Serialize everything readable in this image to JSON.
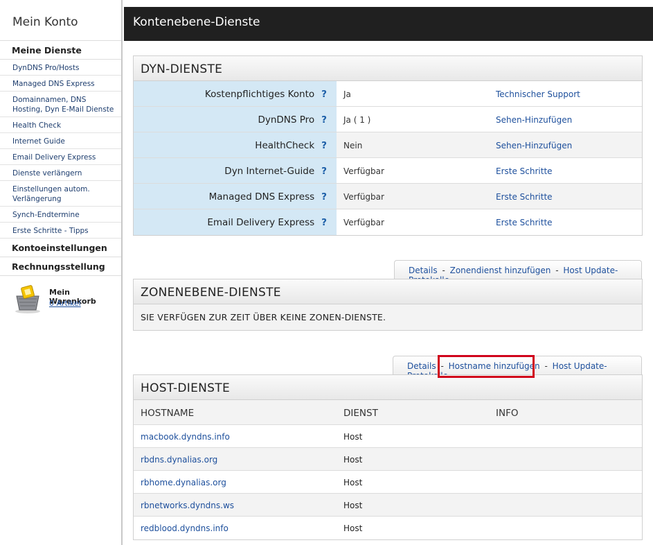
{
  "sidebar": {
    "title": "Mein Konto",
    "section_services": "Meine Dienste",
    "items": [
      "DynDNS Pro/Hosts",
      "Managed DNS Express",
      "Domainnamen, DNS Hosting, Dyn E-Mail Dienste",
      "Health Check",
      "Internet Guide",
      "Email Delivery Express",
      "Dienste verlängern",
      "Einstellungen autom. Verlängerung",
      "Synch-Endtermine",
      "Erste Schritte - Tipps"
    ],
    "section_account": "Kontoeinstellungen",
    "section_billing": "Rechnungsstellung",
    "cart": {
      "title": "Mein Warenkorb",
      "count": "0 Artikel"
    }
  },
  "header": {
    "title": "Kontenebene-Dienste"
  },
  "dyn": {
    "title": "DYN-DIENSTE",
    "help": "?",
    "rows": [
      {
        "label": "Kostenpflichtiges Konto",
        "value": "Ja",
        "link": "Technischer Support"
      },
      {
        "label": "DynDNS Pro",
        "value": "Ja ( 1 )",
        "link": "Sehen-Hinzufügen"
      },
      {
        "label": "HealthCheck",
        "value": "Nein",
        "link": "Sehen-Hinzufügen"
      },
      {
        "label": "Dyn Internet-Guide",
        "value": "Verfügbar",
        "link": "Erste Schritte"
      },
      {
        "label": "Managed DNS Express",
        "value": "Verfügbar",
        "link": "Erste Schritte"
      },
      {
        "label": "Email Delivery Express",
        "value": "Verfügbar",
        "link": "Erste Schritte"
      }
    ]
  },
  "zone": {
    "tabs": {
      "details": "Details",
      "add": "Zonendienst hinzufügen",
      "log": "Host Update-Protokolle",
      "sep": "-"
    },
    "title": "ZONENEBENE-DIENSTE",
    "message": "SIE VERFÜGEN ZUR ZEIT ÜBER KEINE ZONEN-DIENSTE."
  },
  "host": {
    "tabs": {
      "details": "Details",
      "add": "Hostname hinzufügen",
      "log": "Host Update-Protokolle",
      "sep": "-"
    },
    "title": "HOST-DIENSTE",
    "columns": {
      "hostname": "HOSTNAME",
      "service": "DIENST",
      "info": "INFO"
    },
    "rows": [
      {
        "hostname": "macbook.dyndns.info",
        "service": "Host"
      },
      {
        "hostname": "rbdns.dynalias.org",
        "service": "Host"
      },
      {
        "hostname": "rbhome.dynalias.org",
        "service": "Host"
      },
      {
        "hostname": "rbnetworks.dyndns.ws",
        "service": "Host"
      },
      {
        "hostname": "redblood.dyndns.info",
        "service": "Host"
      }
    ]
  },
  "colors": {
    "header_bg": "#202020",
    "label_bg": "#d4e8f5",
    "link": "#1d4f9c",
    "highlight": "#d0021b"
  }
}
